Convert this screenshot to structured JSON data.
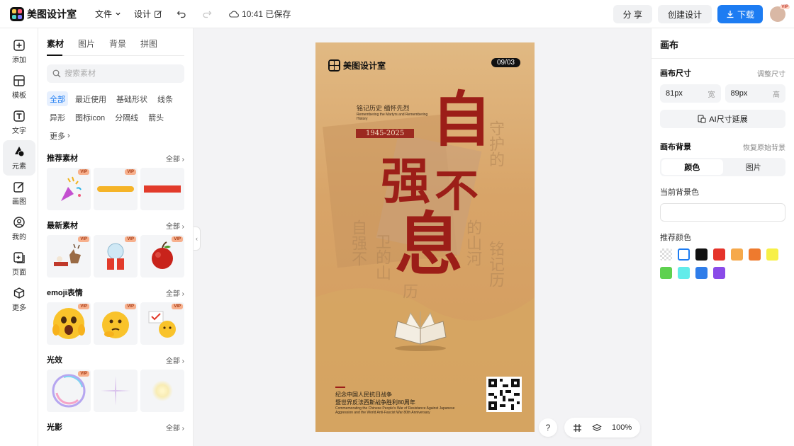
{
  "app": {
    "name": "美图设计室"
  },
  "topbar": {
    "file_menu": "文件",
    "design_menu": "设计",
    "saved_status": "10:41 已保存",
    "share_label": "分 享",
    "create_label": "创建设计",
    "download_label": "下载",
    "avatar_badge": "VIP"
  },
  "leftnav": {
    "items": [
      {
        "label": "添加",
        "icon": "plus-square-icon"
      },
      {
        "label": "模板",
        "icon": "template-icon"
      },
      {
        "label": "文字",
        "icon": "text-icon"
      },
      {
        "label": "元素",
        "icon": "shapes-icon"
      },
      {
        "label": "画图",
        "icon": "draw-icon"
      },
      {
        "label": "我的",
        "icon": "user-icon"
      },
      {
        "label": "页面",
        "icon": "page-icon"
      },
      {
        "label": "更多",
        "icon": "cube-icon"
      }
    ],
    "active": "元素"
  },
  "panel": {
    "tabs": [
      "素材",
      "图片",
      "背景",
      "拼图"
    ],
    "active_tab": "素材",
    "search_placeholder": "搜索素材",
    "chips": [
      "全部",
      "最近使用",
      "基础形状",
      "线条",
      "异形",
      "图标icon",
      "分隔线",
      "箭头",
      "更多"
    ],
    "active_chip": "全部",
    "vip_badge": "VIP",
    "sections": [
      {
        "title": "推荐素材",
        "all": "全部"
      },
      {
        "title": "最新素材",
        "all": "全部"
      },
      {
        "title": "emoji表情",
        "all": "全部"
      },
      {
        "title": "光效",
        "all": "全部"
      },
      {
        "title": "光影",
        "all": "全部"
      }
    ]
  },
  "poster": {
    "logo_text": "美图设计室",
    "date": "09/03",
    "headline_small": "铭记历史 缅怀先烈",
    "headline_small_en": "Remembering the Martyrs and Remembering History",
    "years": "1945-2025",
    "big_chars": [
      "自",
      "强",
      "不",
      "息"
    ],
    "ghost_cols": [
      "自强不",
      "卫的山",
      "历",
      "铭记历",
      "守护的",
      "的山河"
    ],
    "bottom_line1": "纪念中国人民抗日战争",
    "bottom_line2": "暨世界反法西斯战争胜利80周年",
    "bottom_en": "Commemorating the Chinese People's War of Resistance Against Japanese Aggression and the World Anti-Fascist War 80th Anniversary",
    "colors": {
      "paper": "#d9a76a",
      "ink": "#9c1e18"
    }
  },
  "canvas_tools": {
    "help": "?",
    "zoom": "100%"
  },
  "rightpanel": {
    "title": "画布",
    "size_label": "画布尺寸",
    "adjust_size": "调整尺寸",
    "width_value": "81px",
    "width_unit": "宽",
    "height_value": "89px",
    "height_unit": "高",
    "ai_button": "AI尺寸延展",
    "bg_label": "画布背景",
    "restore_bg": "恢复原始背景",
    "seg_color": "颜色",
    "seg_image": "图片",
    "current_bg_label": "当前背景色",
    "recommended_label": "推荐颜色",
    "swatches": [
      "transparent",
      "#ffffff",
      "#111111",
      "#e5332a",
      "#f6a94b",
      "#ee7a2e",
      "#f7f046",
      "#5ed14f",
      "#62ecea",
      "#2f7de9",
      "#8a4be8"
    ]
  }
}
